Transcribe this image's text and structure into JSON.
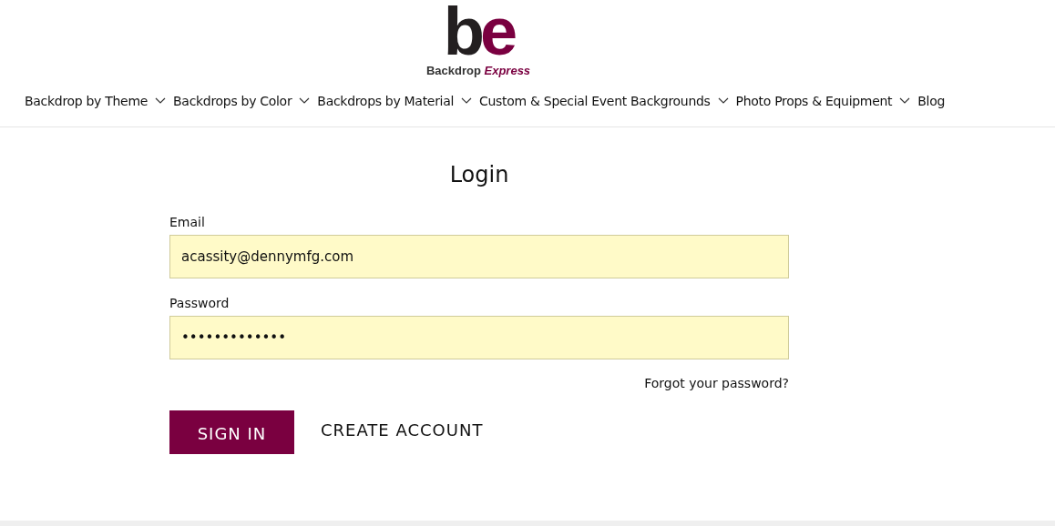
{
  "logo": {
    "letter_1": "b",
    "letter_2": "e",
    "word_1": "Backdrop",
    "word_2": "Express"
  },
  "nav": [
    {
      "label": "Backdrop by Theme",
      "has_menu": true
    },
    {
      "label": "Backdrops by Color",
      "has_menu": true
    },
    {
      "label": "Backdrops by Material",
      "has_menu": true
    },
    {
      "label": "Custom & Special Event Backgrounds",
      "has_menu": true
    },
    {
      "label": "Photo Props & Equipment",
      "has_menu": true
    },
    {
      "label": "Blog",
      "has_menu": false
    }
  ],
  "form": {
    "title": "Login",
    "fields": [
      {
        "label": "Email",
        "value": "acassity@dennymfg.com"
      },
      {
        "label": "Password",
        "value": "•••••••••••••"
      }
    ],
    "forgot_link": "Forgot your password?",
    "sign_in": "SIGN IN",
    "create_account": "CREATE ACCOUNT"
  }
}
